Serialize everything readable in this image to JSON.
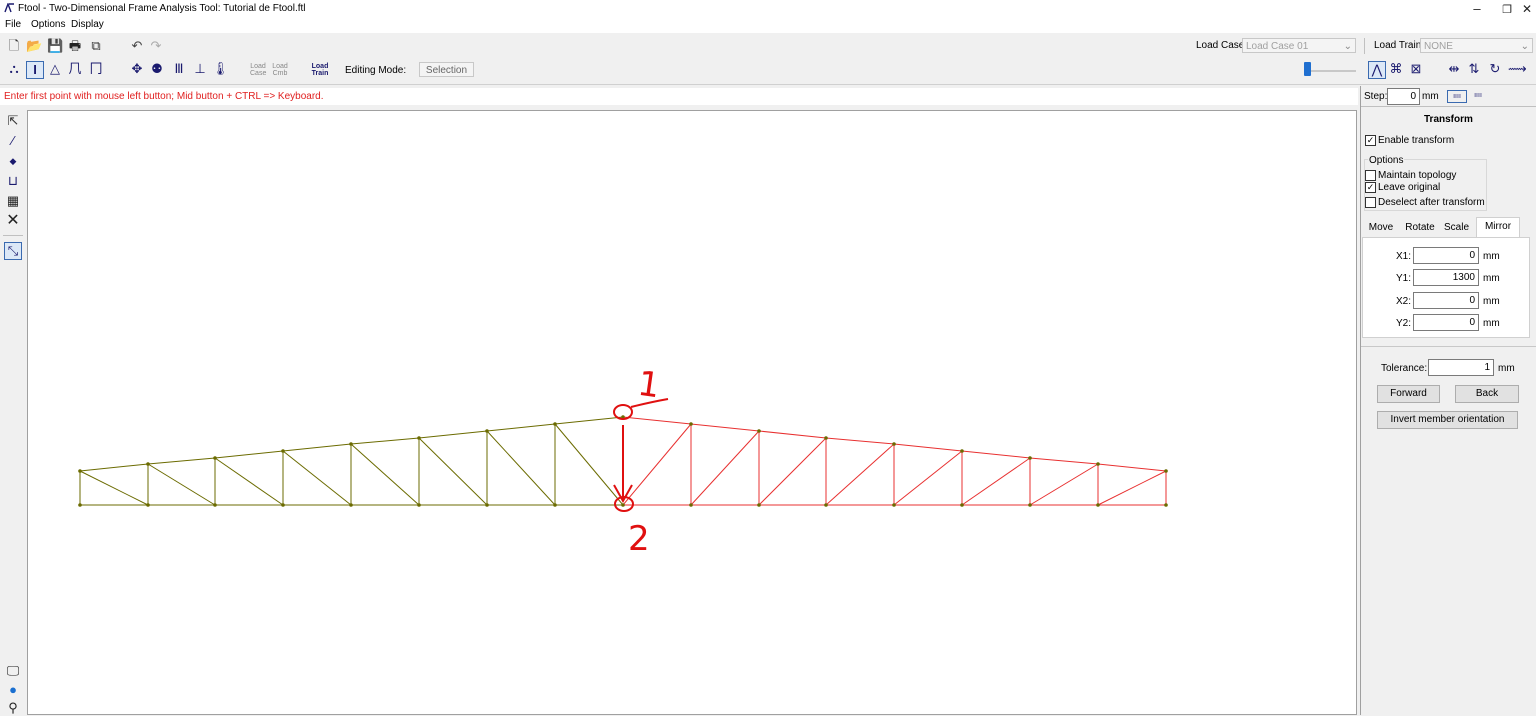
{
  "window": {
    "title": "Ftool - Two-Dimensional Frame Analysis Tool: Tutorial de Ftool.ftl",
    "minimize": "–",
    "restore": "❐",
    "close": "✕"
  },
  "menu": [
    "File",
    "Options",
    "Display"
  ],
  "toolbar": {
    "load_case_label": "Load Case:",
    "load_case_value": "Load Case 01",
    "load_train_label": "Load Train:",
    "load_train_value": "NONE",
    "load_case_btn": [
      "Load",
      "Case"
    ],
    "load_cmb_btn": [
      "Load",
      "Cmb"
    ],
    "load_train_btn": [
      "Load",
      "Train"
    ],
    "editing_mode_label": "Editing Mode:",
    "editing_mode_value": "Selection"
  },
  "status_message": "Enter first point with mouse left button; Mid button + CTRL => Keyboard.",
  "step": {
    "label": "Step:",
    "value": "0",
    "unit": "mm"
  },
  "transform": {
    "title": "Transform",
    "enable_label": "Enable transform",
    "enable_checked": true,
    "options_label": "Options",
    "maintain_topology_label": "Maintain topology",
    "maintain_topology_checked": false,
    "leave_original_label": "Leave original",
    "leave_original_checked": true,
    "deselect_after_label": "Deselect after transform",
    "deselect_after_checked": false,
    "tabs": [
      "Move",
      "Rotate",
      "Scale",
      "Mirror"
    ],
    "active_tab": "Mirror",
    "fields": [
      {
        "label": "X1:",
        "value": "0",
        "unit": "mm"
      },
      {
        "label": "Y1:",
        "value": "1300",
        "unit": "mm"
      },
      {
        "label": "X2:",
        "value": "0",
        "unit": "mm"
      },
      {
        "label": "Y2:",
        "value": "0",
        "unit": "mm"
      }
    ],
    "tolerance_label": "Tolerance:",
    "tolerance_value": "1",
    "tolerance_unit": "mm",
    "forward_label": "Forward",
    "back_label": "Back",
    "invert_label": "Invert member orientation"
  },
  "annotations": {
    "point1": "1",
    "point2": "2"
  },
  "colors": {
    "original_truss": "#6b6b00",
    "mirrored_truss": "#e83030",
    "annotation": "#e01010",
    "status_text": "#e02020",
    "slider_thumb": "#1f6fd0"
  }
}
